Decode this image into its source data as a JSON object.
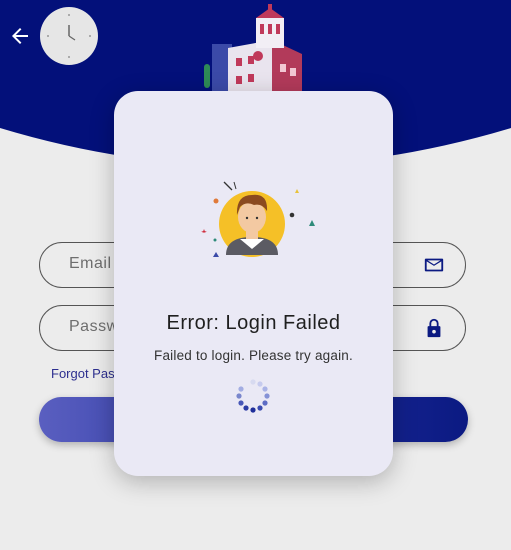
{
  "header": {
    "back_icon": "arrow-left-icon",
    "clock_icon": "clock-icon",
    "illustration": "university-building-illustration",
    "bg_color": "#03107a"
  },
  "form": {
    "email_placeholder": "Email",
    "email_icon": "mail-icon",
    "password_placeholder": "Passw",
    "password_icon": "lock-icon",
    "forgot_link": "Forgot Pas",
    "accent_color": "#0b1a82"
  },
  "dialog": {
    "title": "Error: Login Failed",
    "message": "Failed to login. Please try again.",
    "avatar_icon": "user-avatar-icon",
    "spinner_icon": "loading-spinner-icon",
    "bg_color": "#eae9f5"
  }
}
